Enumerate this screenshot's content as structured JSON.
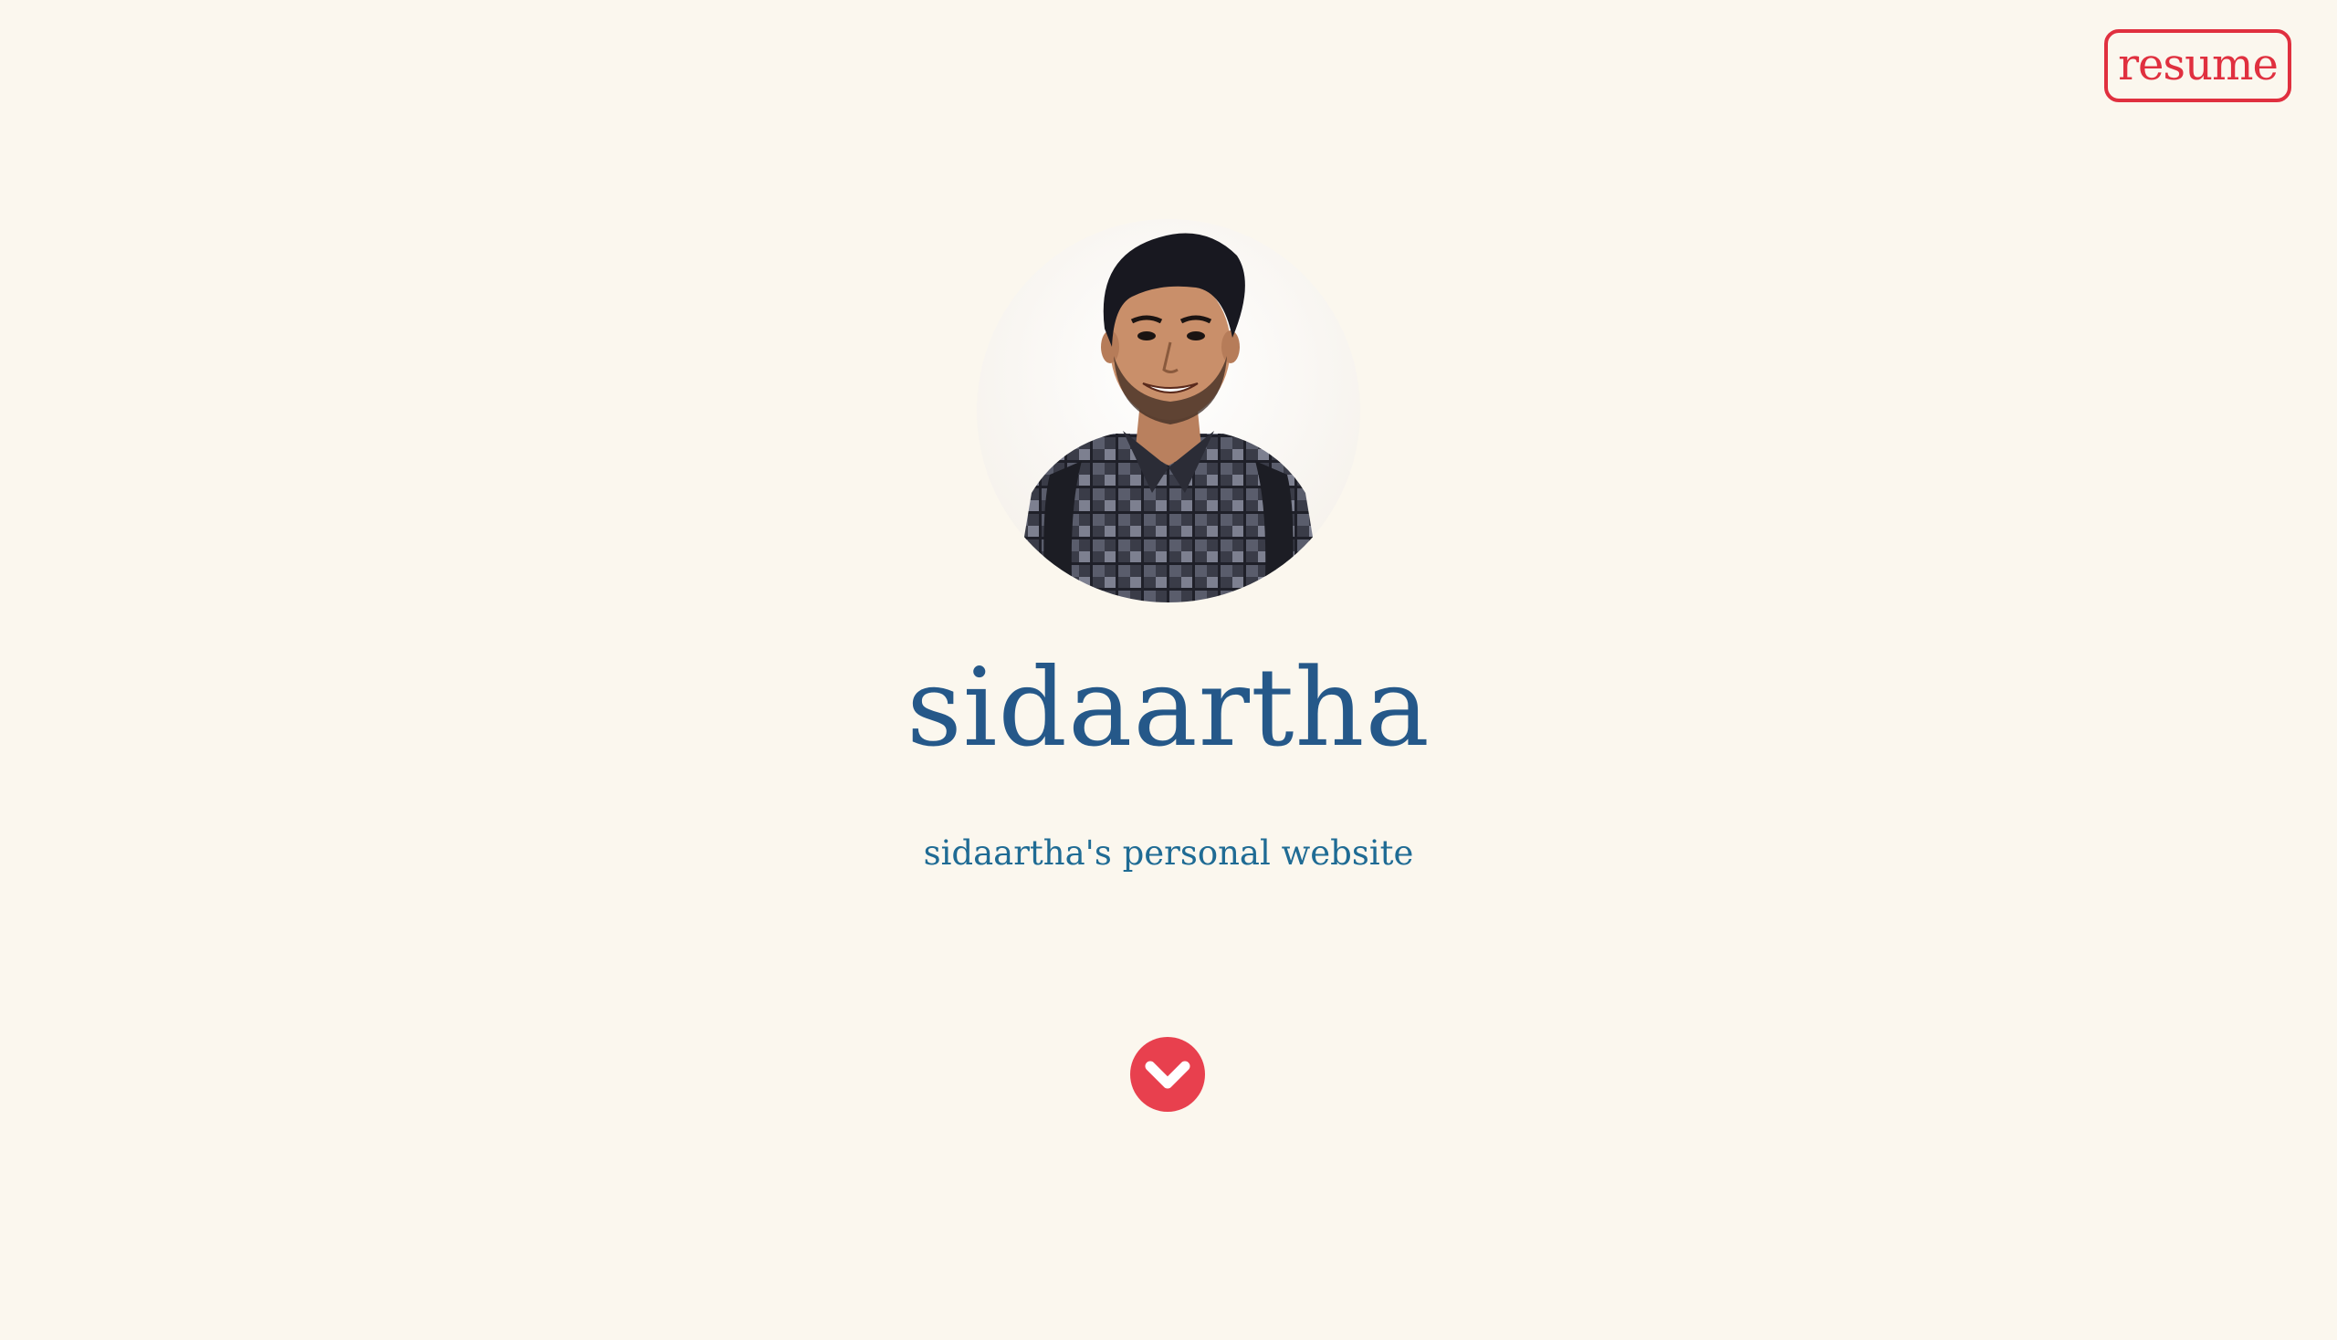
{
  "header": {
    "resume_label": "resume"
  },
  "hero": {
    "title": "sidaartha",
    "tagline": "sidaartha's personal website"
  },
  "icons": {
    "avatar": "profile-photo",
    "scroll": "chevron-down-icon"
  },
  "colors": {
    "background": "#fbf7ee",
    "accent": "#e0303f",
    "title": "#255889",
    "tagline": "#1f6b94",
    "scroll_button": "#e8404e"
  }
}
